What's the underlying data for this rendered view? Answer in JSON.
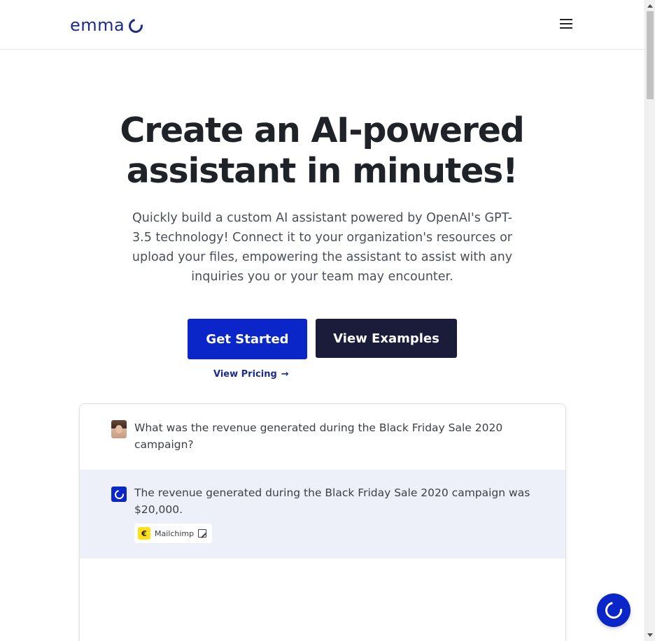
{
  "header": {
    "logo_text": "emma",
    "logo_icon": "ring-logo-icon",
    "menu_icon": "hamburger-menu-icon"
  },
  "hero": {
    "title": "Create an AI-powered assistant in minutes!",
    "subtitle": "Quickly build a custom AI assistant powered by OpenAI's GPT-3.5 technology! Connect it to your organization's resources or upload your files, empowering the assistant to assist with any inquiries you or your team may encounter.",
    "primary_button": "Get Started",
    "secondary_button": "View Examples",
    "pricing_link": "View Pricing",
    "pricing_arrow": "→"
  },
  "chat": {
    "user_message": "What was the revenue generated during the Black Friday Sale 2020 campaign?",
    "bot_message": "The revenue generated during the Black Friday Sale 2020 campaign was $20,000.",
    "source_label": "Mailchimp",
    "source_icon": "mailchimp-icon"
  },
  "colors": {
    "brand_blue": "#0a25c8",
    "dark_navy": "#1a1c3a",
    "logo_blue": "#1c2b8c",
    "bot_bg": "#eef0f9"
  }
}
